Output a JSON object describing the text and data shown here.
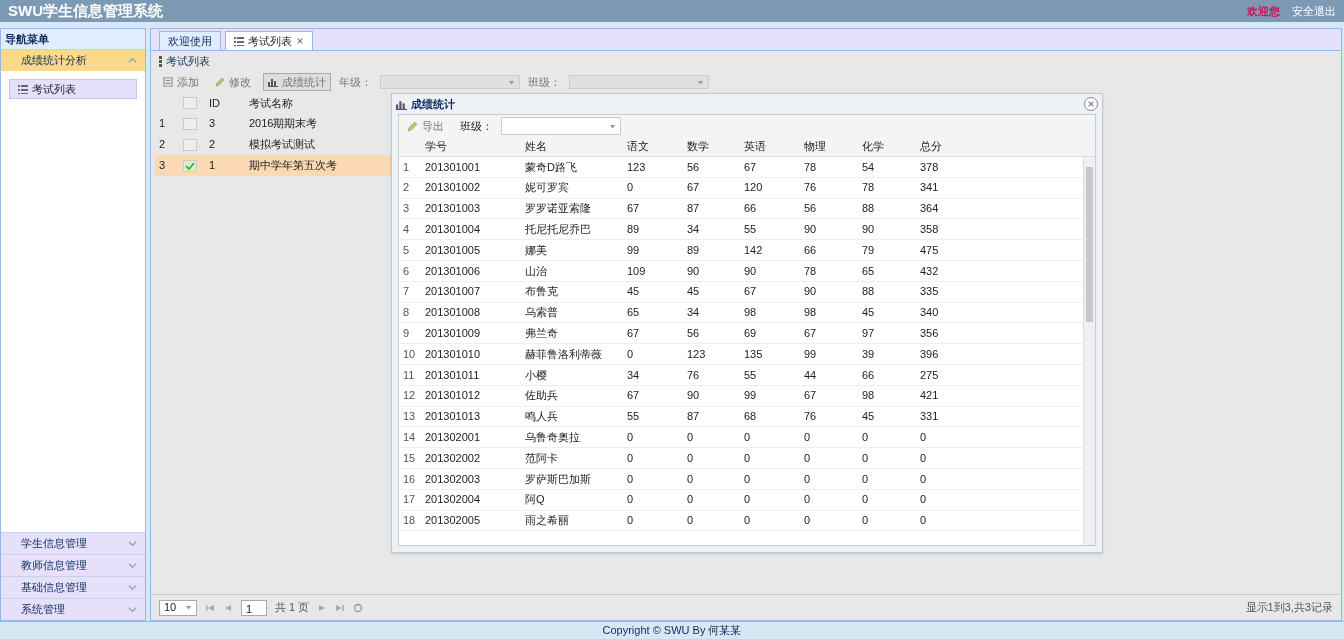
{
  "header": {
    "title": "SWU学生信息管理系统",
    "welcome": "欢迎您",
    "logout": "安全退出"
  },
  "sidebar": {
    "title": "导航菜单",
    "panels": [
      {
        "label": "成绩统计分析",
        "expanded": true,
        "children": [
          {
            "label": "考试列表",
            "selected": true
          }
        ]
      },
      {
        "label": "学生信息管理",
        "expanded": false
      },
      {
        "label": "教师信息管理",
        "expanded": false
      },
      {
        "label": "基础信息管理",
        "expanded": false
      },
      {
        "label": "系统管理",
        "expanded": false
      }
    ]
  },
  "tabs": [
    {
      "label": "欢迎使用",
      "selected": false,
      "closable": false
    },
    {
      "label": "考试列表",
      "selected": true,
      "closable": true
    }
  ],
  "panel_title": "考试列表",
  "toolbar": {
    "buttons": [
      "添加",
      "修改",
      "成绩统计"
    ],
    "grade_label": "年级：",
    "class_label": "班级："
  },
  "exam_table": {
    "columns": [
      "ID",
      "考试名称"
    ],
    "all_checked": false,
    "rows": [
      {
        "num": "1",
        "checked": false,
        "id": "3",
        "name": "2016期期末考"
      },
      {
        "num": "2",
        "checked": false,
        "id": "2",
        "name": "模拟考试测试"
      },
      {
        "num": "3",
        "checked": true,
        "id": "1",
        "name": "期中学年第五次考"
      }
    ]
  },
  "pager": {
    "page_size": "10",
    "page": "1",
    "total_pages": "共 1 页",
    "info": "显示1到3,共3记录"
  },
  "dialog": {
    "title": "成绩统计",
    "export": "导出",
    "class_label": "班级：",
    "columns": [
      "",
      "学号",
      "姓名",
      "语文",
      "数学",
      "英语",
      "物理",
      "化学",
      "总分"
    ],
    "rows": [
      [
        "1",
        "201301001",
        "蒙奇D路飞",
        "123",
        "56",
        "67",
        "78",
        "54",
        "378"
      ],
      [
        "2",
        "201301002",
        "妮可罗宾",
        "0",
        "67",
        "120",
        "76",
        "78",
        "341"
      ],
      [
        "3",
        "201301003",
        "罗罗诺亚索隆",
        "67",
        "87",
        "66",
        "56",
        "88",
        "364"
      ],
      [
        "4",
        "201301004",
        "托尼托尼乔巴",
        "89",
        "34",
        "55",
        "90",
        "90",
        "358"
      ],
      [
        "5",
        "201301005",
        "娜美",
        "99",
        "89",
        "142",
        "66",
        "79",
        "475"
      ],
      [
        "6",
        "201301006",
        "山治",
        "109",
        "90",
        "90",
        "78",
        "65",
        "432"
      ],
      [
        "7",
        "201301007",
        "布鲁克",
        "45",
        "45",
        "67",
        "90",
        "88",
        "335"
      ],
      [
        "8",
        "201301008",
        "乌索普",
        "65",
        "34",
        "98",
        "98",
        "45",
        "340"
      ],
      [
        "9",
        "201301009",
        "弗兰奇",
        "67",
        "56",
        "69",
        "67",
        "97",
        "356"
      ],
      [
        "10",
        "201301010",
        "赫菲鲁洛利蒂薇",
        "0",
        "123",
        "135",
        "99",
        "39",
        "396"
      ],
      [
        "11",
        "201301011",
        "小樱",
        "34",
        "76",
        "55",
        "44",
        "66",
        "275"
      ],
      [
        "12",
        "201301012",
        "佐助兵",
        "67",
        "90",
        "99",
        "67",
        "98",
        "421"
      ],
      [
        "13",
        "201301013",
        "鸣人兵",
        "55",
        "87",
        "68",
        "76",
        "45",
        "331"
      ],
      [
        "14",
        "201302001",
        "乌鲁奇奥拉",
        "0",
        "0",
        "0",
        "0",
        "0",
        "0"
      ],
      [
        "15",
        "201302002",
        "范阿卡",
        "0",
        "0",
        "0",
        "0",
        "0",
        "0"
      ],
      [
        "16",
        "201302003",
        "罗萨斯巴加斯",
        "0",
        "0",
        "0",
        "0",
        "0",
        "0"
      ],
      [
        "17",
        "201302004",
        "阿Q",
        "0",
        "0",
        "0",
        "0",
        "0",
        "0"
      ],
      [
        "18",
        "201302005",
        "雨之希丽",
        "0",
        "0",
        "0",
        "0",
        "0",
        "0"
      ]
    ]
  },
  "footer": "Copyright © SWU By 何某某"
}
